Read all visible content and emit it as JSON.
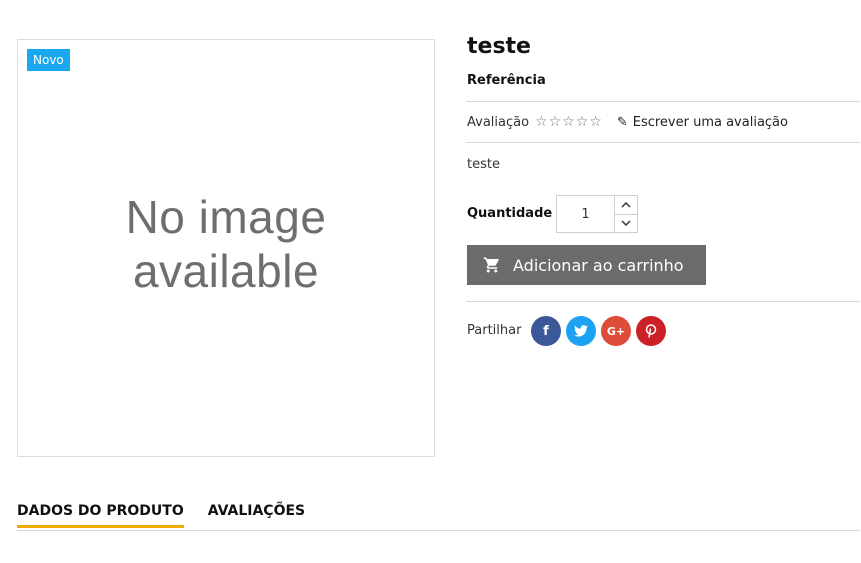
{
  "product": {
    "badge": "Novo",
    "image_placeholder_line1": "No image",
    "image_placeholder_line2": "available",
    "title": "teste",
    "reference_label": "Referência",
    "rating_label": "Avaliação",
    "rating_value": 0,
    "rating_max": 5,
    "stars": "☆☆☆☆☆",
    "write_review": "Escrever uma avaliação",
    "description": "teste",
    "quantity_label": "Quantidade",
    "quantity_value": "1",
    "add_to_cart": "Adicionar ao carrinho",
    "share_label": "Partilhar"
  },
  "social": [
    {
      "name": "facebook",
      "glyph": "f",
      "color": "#3b5998"
    },
    {
      "name": "twitter",
      "glyph": "t",
      "color": "#1da1f2"
    },
    {
      "name": "google-plus",
      "glyph": "G+",
      "color": "#dd4b39"
    },
    {
      "name": "pinterest",
      "glyph": "P",
      "color": "#cb2027"
    }
  ],
  "tabs": [
    {
      "label": "DADOS DO PRODUTO",
      "active": true
    },
    {
      "label": "AVALIAÇÕES",
      "active": false
    }
  ],
  "colors": {
    "badge": "#19a8f0",
    "button": "#6b6b6b",
    "active_tab_underline": "#f2a900"
  }
}
